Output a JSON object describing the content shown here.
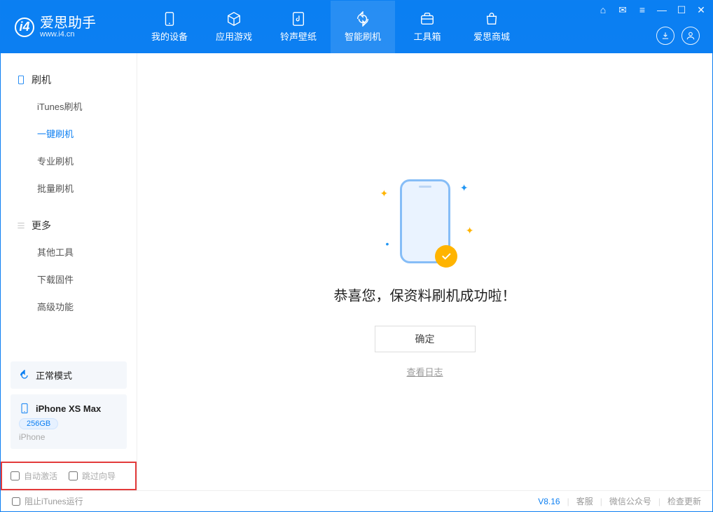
{
  "app": {
    "name": "爱思助手",
    "site": "www.i4.cn"
  },
  "nav": {
    "items": [
      {
        "label": "我的设备"
      },
      {
        "label": "应用游戏"
      },
      {
        "label": "铃声壁纸"
      },
      {
        "label": "智能刷机"
      },
      {
        "label": "工具箱"
      },
      {
        "label": "爱思商城"
      }
    ]
  },
  "sidebar": {
    "group_flash": "刷机",
    "group_more": "更多",
    "flash_items": [
      {
        "label": "iTunes刷机"
      },
      {
        "label": "一键刷机"
      },
      {
        "label": "专业刷机"
      },
      {
        "label": "批量刷机"
      }
    ],
    "more_items": [
      {
        "label": "其他工具"
      },
      {
        "label": "下载固件"
      },
      {
        "label": "高级功能"
      }
    ]
  },
  "device": {
    "mode": "正常模式",
    "name": "iPhone XS Max",
    "capacity": "256GB",
    "type": "iPhone"
  },
  "options": {
    "auto_activate": "自动激活",
    "skip_wizard": "跳过向导"
  },
  "main": {
    "success_text": "恭喜您，保资料刷机成功啦！",
    "ok_label": "确定",
    "view_log": "查看日志"
  },
  "status": {
    "block_itunes": "阻止iTunes运行",
    "version": "V8.16",
    "support": "客服",
    "wechat": "微信公众号",
    "update": "检查更新"
  }
}
